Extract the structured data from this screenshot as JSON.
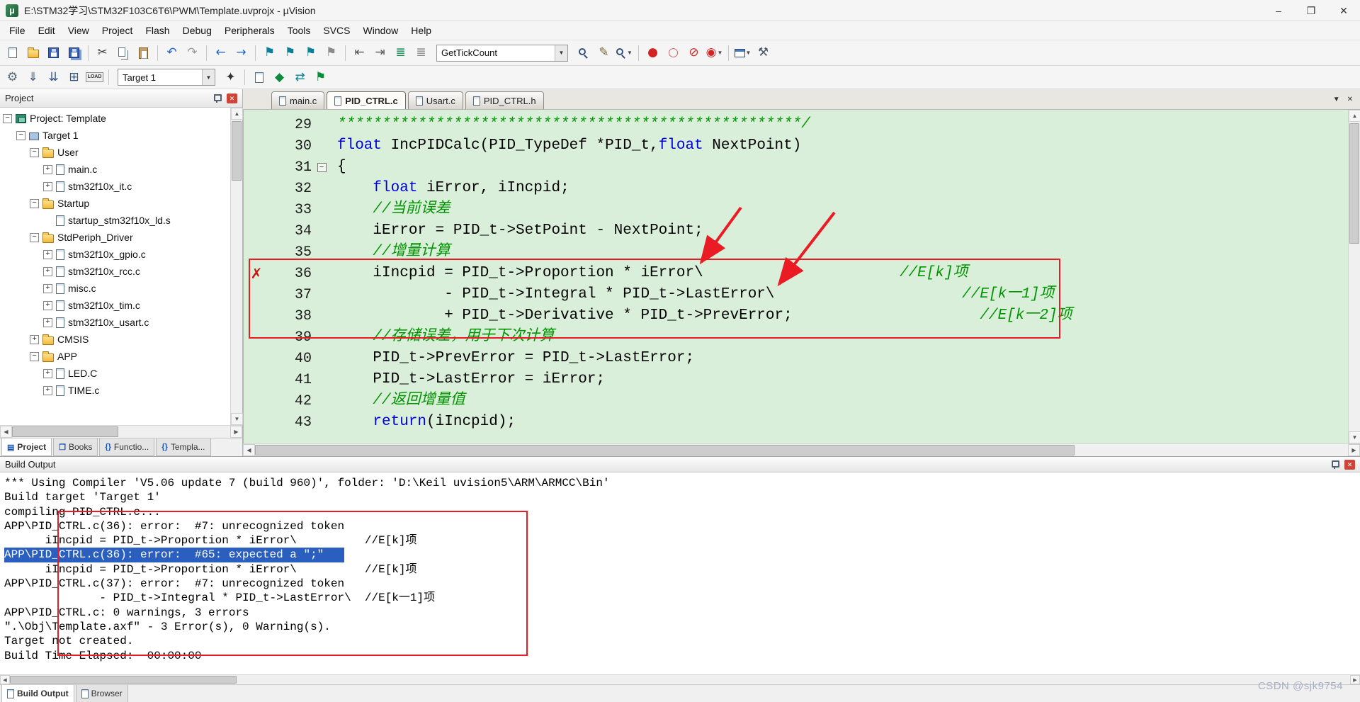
{
  "window": {
    "title": "E:\\STM32学习\\STM32F103C6T6\\PWM\\Template.uvprojx - µVision",
    "watermark": "CSDN @sjk9754"
  },
  "glyphs": {
    "logo": "µ",
    "minimize": "–",
    "maximize": "❐",
    "close": "✕",
    "close_small": "✕",
    "dropdown": "▼",
    "up": "▲",
    "down": "▼",
    "left": "◀",
    "right": "▶",
    "error": "✗",
    "fold_open": "−",
    "plus": "+",
    "minus": "−"
  },
  "menu": [
    "File",
    "Edit",
    "View",
    "Project",
    "Flash",
    "Debug",
    "Peripherals",
    "Tools",
    "SVCS",
    "Window",
    "Help"
  ],
  "toolbar1": {
    "combo_value": "GetTickCount",
    "items": [
      {
        "n": "new-file-icon",
        "t": "page"
      },
      {
        "n": "open-file-icon",
        "t": "folder"
      },
      {
        "n": "save-icon",
        "t": "floppy"
      },
      {
        "n": "save-all-icon",
        "t": "floppy2"
      },
      {
        "sep": true
      },
      {
        "n": "cut-icon",
        "t": "g",
        "g": "✂",
        "c": "#3a3a3a"
      },
      {
        "n": "copy-icon",
        "t": "copy"
      },
      {
        "n": "paste-icon",
        "t": "paste"
      },
      {
        "sep": true
      },
      {
        "n": "undo-icon",
        "t": "g",
        "g": "↶",
        "c": "#1f64c8"
      },
      {
        "n": "redo-icon",
        "t": "g",
        "g": "↷",
        "c": "#9a9a9a"
      },
      {
        "sep": true
      },
      {
        "n": "navigate-back-icon",
        "t": "g",
        "g": "←",
        "c": "#1f64c8"
      },
      {
        "n": "navigate-forward-icon",
        "t": "g",
        "g": "→",
        "c": "#1f64c8"
      },
      {
        "sep": true
      },
      {
        "n": "bookmark-toggle-icon",
        "t": "g",
        "g": "⚑",
        "c": "#0b7f95"
      },
      {
        "n": "bookmark-prev-icon",
        "t": "g",
        "g": "⚑",
        "c": "#0b7f95"
      },
      {
        "n": "bookmark-next-icon",
        "t": "g",
        "g": "⚑",
        "c": "#0b7f95"
      },
      {
        "n": "bookmark-clear-icon",
        "t": "g",
        "g": "⚑",
        "c": "#8b8b8b"
      },
      {
        "sep": true
      },
      {
        "n": "outdent-icon",
        "t": "g",
        "g": "⇤",
        "c": "#555555"
      },
      {
        "n": "indent-icon",
        "t": "g",
        "g": "⇥",
        "c": "#555555"
      },
      {
        "n": "comment-selection-icon",
        "t": "g",
        "g": "≣",
        "c": "#0a8c50"
      },
      {
        "n": "uncomment-selection-icon",
        "t": "g",
        "g": "≣",
        "c": "#888888"
      },
      {
        "combo": "tick"
      },
      {
        "n": "find-in-files-icon",
        "t": "mag"
      },
      {
        "n": "incremental-find-icon",
        "t": "g",
        "g": "✎",
        "c": "#7c6a34"
      },
      {
        "n": "find-icon",
        "t": "mag",
        "dd": true
      },
      {
        "sep": true
      },
      {
        "n": "insert-breakpoint-icon",
        "t": "g",
        "g": "●",
        "c": "#d22222"
      },
      {
        "n": "disable-breakpoint-icon",
        "t": "g",
        "g": "○",
        "c": "#c66666"
      },
      {
        "n": "kill-breakpoints-icon",
        "t": "g",
        "g": "⊘",
        "c": "#d22222"
      },
      {
        "n": "breakpoint-options-icon",
        "t": "g",
        "g": "◉",
        "c": "#d22222",
        "dd": true
      },
      {
        "sep": true
      },
      {
        "n": "window-layout-icon",
        "t": "win",
        "dd": true
      },
      {
        "n": "wrench-icon",
        "t": "g",
        "g": "⚒",
        "c": "#4a5a6a"
      }
    ]
  },
  "toolbar2": {
    "target_value": "Target 1",
    "load_label": "LOAD",
    "items": [
      {
        "n": "translate-icon",
        "t": "g",
        "g": "⚙",
        "c": "#5a6a7a"
      },
      {
        "n": "build-icon",
        "t": "g",
        "g": "⇓",
        "c": "#33558a"
      },
      {
        "n": "rebuild-icon",
        "t": "g",
        "g": "⇊",
        "c": "#33558a"
      },
      {
        "n": "batch-build-icon",
        "t": "g",
        "g": "⊞",
        "c": "#33558a"
      },
      {
        "n": "download-icon",
        "t": "load"
      },
      {
        "sep": true
      },
      {
        "combo": "target"
      },
      {
        "n": "target-options-icon",
        "t": "g",
        "g": "✦",
        "c": "#333333"
      },
      {
        "sep": true
      },
      {
        "n": "file-extensions-icon",
        "t": "page"
      },
      {
        "n": "goto-next-icon",
        "t": "g",
        "g": "◆",
        "c": "#0a8c3c"
      },
      {
        "n": "environment-icon",
        "t": "g",
        "g": "⇄",
        "c": "#0b7f95"
      },
      {
        "n": "manage-components-icon",
        "t": "g",
        "g": "⚑",
        "c": "#0a8c3c"
      }
    ]
  },
  "project_panel": {
    "title": "Project",
    "tree": [
      {
        "label": "Project: Template",
        "depth": 0,
        "exp": "-",
        "icon": "root"
      },
      {
        "label": "Target 1",
        "depth": 1,
        "exp": "-",
        "icon": "chip"
      },
      {
        "label": "User",
        "depth": 2,
        "exp": "-",
        "icon": "folder"
      },
      {
        "label": "main.c",
        "depth": 3,
        "exp": "+",
        "icon": "page"
      },
      {
        "label": "stm32f10x_it.c",
        "depth": 3,
        "exp": "+",
        "icon": "page"
      },
      {
        "label": "Startup",
        "depth": 2,
        "exp": "-",
        "icon": "folder"
      },
      {
        "label": "startup_stm32f10x_ld.s",
        "depth": 3,
        "exp": "",
        "icon": "page"
      },
      {
        "label": "StdPeriph_Driver",
        "depth": 2,
        "exp": "-",
        "icon": "folder"
      },
      {
        "label": "stm32f10x_gpio.c",
        "depth": 3,
        "exp": "+",
        "icon": "page"
      },
      {
        "label": "stm32f10x_rcc.c",
        "depth": 3,
        "exp": "+",
        "icon": "page"
      },
      {
        "label": "misc.c",
        "depth": 3,
        "exp": "+",
        "icon": "page"
      },
      {
        "label": "stm32f10x_tim.c",
        "depth": 3,
        "exp": "+",
        "icon": "page"
      },
      {
        "label": "stm32f10x_usart.c",
        "depth": 3,
        "exp": "+",
        "icon": "page"
      },
      {
        "label": "CMSIS",
        "depth": 2,
        "exp": "+",
        "icon": "folder"
      },
      {
        "label": "APP",
        "depth": 2,
        "exp": "-",
        "icon": "folder"
      },
      {
        "label": "LED.C",
        "depth": 3,
        "exp": "+",
        "icon": "page"
      },
      {
        "label": "TIME.c",
        "depth": 3,
        "exp": "+",
        "icon": "page"
      }
    ],
    "tabs": [
      {
        "label": "Project",
        "icon": "▤",
        "active": true
      },
      {
        "label": "Books",
        "icon": "❒"
      },
      {
        "label": "Functio...",
        "icon": "{}"
      },
      {
        "label": "Templa...",
        "icon": "{}"
      }
    ]
  },
  "editor": {
    "tabs": [
      {
        "label": "main.c"
      },
      {
        "label": "PID_CTRL.c",
        "active": true
      },
      {
        "label": "Usart.c"
      },
      {
        "label": "PID_CTRL.h"
      }
    ],
    "lines": [
      {
        "num": 29,
        "segs": [
          [
            "c",
            "****************************************************/"
          ]
        ]
      },
      {
        "num": 30,
        "segs": [
          [
            "k",
            "float"
          ],
          [
            "p",
            " IncPIDCalc(PID_TypeDef *PID_t,"
          ],
          [
            "k",
            "float"
          ],
          [
            "p",
            " NextPoint)"
          ]
        ]
      },
      {
        "num": 31,
        "fold": true,
        "segs": [
          [
            "p",
            "{"
          ]
        ]
      },
      {
        "num": 32,
        "segs": [
          [
            "p",
            "    "
          ],
          [
            "k",
            "float"
          ],
          [
            "p",
            " iError, iIncpid;"
          ]
        ]
      },
      {
        "num": 33,
        "segs": [
          [
            "p",
            "    "
          ],
          [
            "c",
            "//当前误差"
          ]
        ]
      },
      {
        "num": 34,
        "segs": [
          [
            "p",
            "    iError = PID_t->SetPoint - NextPoint;"
          ]
        ]
      },
      {
        "num": 35,
        "segs": [
          [
            "p",
            "    "
          ],
          [
            "c",
            "//增量计算"
          ]
        ]
      },
      {
        "num": 36,
        "err": true,
        "segs": [
          [
            "p",
            "    iIncpid = PID_t->Proportion * iError\\"
          ],
          [
            "p",
            "                      "
          ],
          [
            "c",
            "//E[k]项"
          ]
        ]
      },
      {
        "num": 37,
        "segs": [
          [
            "p",
            "            - PID_t->Integral * PID_t->LastError\\"
          ],
          [
            "p",
            "                     "
          ],
          [
            "c",
            "//E[k一1]项"
          ]
        ]
      },
      {
        "num": 38,
        "segs": [
          [
            "p",
            "            + PID_t->Derivative * PID_t->PrevError;"
          ],
          [
            "p",
            "                     "
          ],
          [
            "c",
            "//E[k一2]项"
          ]
        ]
      },
      {
        "num": 39,
        "segs": [
          [
            "p",
            "    "
          ],
          [
            "c",
            "//存储误差，用于下次计算"
          ]
        ]
      },
      {
        "num": 40,
        "segs": [
          [
            "p",
            "    PID_t->PrevError = PID_t->LastError;"
          ]
        ]
      },
      {
        "num": 41,
        "segs": [
          [
            "p",
            "    PID_t->LastError = iError;"
          ]
        ]
      },
      {
        "num": 42,
        "segs": [
          [
            "p",
            "    "
          ],
          [
            "c",
            "//返回增量值"
          ]
        ]
      },
      {
        "num": 43,
        "segs": [
          [
            "p",
            "    "
          ],
          [
            "k",
            "return"
          ],
          [
            "p",
            "(iIncpid);"
          ]
        ]
      }
    ]
  },
  "build_output": {
    "title": "Build Output",
    "lines": [
      {
        "text": "*** Using Compiler 'V5.06 update 7 (build 960)', folder: 'D:\\Keil uvision5\\ARM\\ARMCC\\Bin'"
      },
      {
        "text": "Build target 'Target 1'"
      },
      {
        "text": "compiling PID_CTRL.c..."
      },
      {
        "text": "APP\\PID_CTRL.c(36): error:  #7: unrecognized token"
      },
      {
        "text": "      iIncpid = PID_t->Proportion * iError\\          //E[k]项"
      },
      {
        "text": "APP\\PID_CTRL.c(36): error:  #65: expected a \";\"",
        "sel": true
      },
      {
        "text": "      iIncpid = PID_t->Proportion * iError\\          //E[k]项"
      },
      {
        "text": "APP\\PID_CTRL.c(37): error:  #7: unrecognized token"
      },
      {
        "text": "              - PID_t->Integral * PID_t->LastError\\  //E[k一1]项"
      },
      {
        "text": "APP\\PID_CTRL.c: 0 warnings, 3 errors"
      },
      {
        "text": "\".\\Obj\\Template.axf\" - 3 Error(s), 0 Warning(s)."
      },
      {
        "text": "Target not created."
      },
      {
        "text": "Build Time Elapsed:  00:00:00"
      }
    ],
    "tabs": [
      {
        "label": "Build Output",
        "active": true
      },
      {
        "label": "Browser"
      }
    ]
  }
}
